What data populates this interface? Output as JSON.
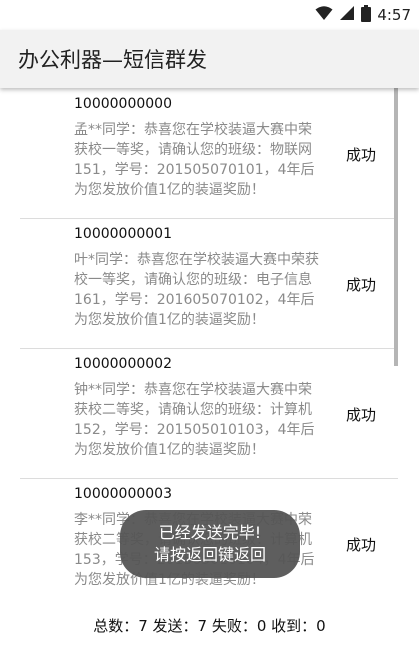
{
  "status_bar": {
    "time": "4:57",
    "icons": [
      "wifi-icon",
      "signal-icon",
      "battery-icon"
    ]
  },
  "app_bar": {
    "title": "办公利器—短信群发"
  },
  "messages": [
    {
      "phone": "10000000000",
      "text": "孟**同学：恭喜您在学校装逼大赛中荣获校一等奖，请确认您的班级：物联网151，学号：201505070101，4年后为您发放价值1亿的装逼奖励！",
      "status": "成功"
    },
    {
      "phone": "10000000001",
      "text": "叶*同学：恭喜您在学校装逼大赛中荣获校一等奖，请确认您的班级：电子信息161，学号：201605070102，4年后为您发放价值1亿的装逼奖励！",
      "status": "成功"
    },
    {
      "phone": "10000000002",
      "text": "钟**同学：恭喜您在学校装逼大赛中荣获校二等奖，请确认您的班级：计算机152，学号：201505010103，4年后为您发放价值1亿的装逼奖励！",
      "status": "成功"
    },
    {
      "phone": "10000000003",
      "text": "李**同学：恭喜您在学校装逼大赛中荣获校二等奖，请确认您的班级：计算机153，学号：201505010104，4年后为您发放价值1亿的装逼奖励！",
      "status": "成功"
    }
  ],
  "toast": {
    "line1": "已经发送完毕!",
    "line2": "请按返回键返回"
  },
  "footer": {
    "summary": "总数：7  发送：7  失败：0  收到：0"
  }
}
